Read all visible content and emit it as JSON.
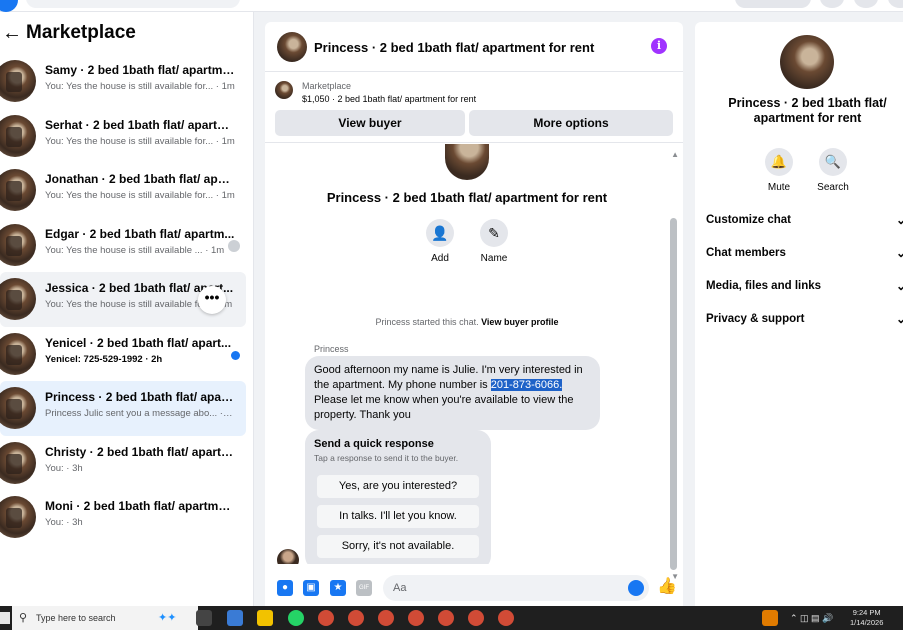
{
  "left": {
    "title": "Marketplace",
    "conversations": [
      {
        "title": "Samy · 2 bed 1bath flat/ apartmen...",
        "preview": "You: Yes the house is still available for... · 1m"
      },
      {
        "title": "Serhat · 2 bed 1bath flat/ apartme...",
        "preview": "You: Yes the house is still available for... · 1m"
      },
      {
        "title": "Jonathan · 2 bed 1bath flat/ apart...",
        "preview": "You: Yes the house is still available for... · 1m"
      },
      {
        "title": "Edgar · 2 bed 1bath flat/ apartm...",
        "preview": "You: Yes the house is still available ... · 1m"
      },
      {
        "title": "Jessica · 2 bed 1bath flat/ apart...",
        "preview": "You: Yes the house is still available fo... · 1m"
      },
      {
        "title": "Yenicel · 2 bed 1bath flat/ apart...",
        "preview": "Yenicel: 725-529-1992 · 2h"
      },
      {
        "title": "Princess · 2 bed 1bath flat/ apartm...",
        "preview": "Princess Julic sent you a message abo... · 2h"
      },
      {
        "title": "Christy · 2 bed 1bath flat/ apartme...",
        "preview": "You: · 3h"
      },
      {
        "title": "Moni · 2 bed 1bath flat/ apartment...",
        "preview": "You: · 3h"
      }
    ],
    "more_glyph": "•••"
  },
  "chat": {
    "title": "Princess · 2 bed 1bath flat/ apartment for rent",
    "info_glyph": "i",
    "listing": {
      "label": "Marketplace",
      "price_line": "$1,050 · 2 bed 1bath flat/ apartment for rent",
      "view_buyer": "View buyer",
      "more_options": "More options"
    },
    "conversation_name": "Princess · 2 bed 1bath flat/ apartment for rent",
    "actions": {
      "add": "Add",
      "name": "Name"
    },
    "started_prefix": "Princess started this chat.",
    "started_link": "View buyer profile",
    "sender": "Princess",
    "message_before": "Good afternoon my name is Julie. I'm very interested in the apartment. My phone number is ",
    "message_phone": "201-873-6066.",
    "message_after": "Please let me know when you're available to view the property. Thank you",
    "quick": {
      "title": "Send a quick response",
      "subtitle": "Tap a response to send it to the buyer.",
      "options": [
        "Yes, are you interested?",
        "In talks. I'll let you know.",
        "Sorry, it's not available."
      ]
    },
    "composer_placeholder": "Aa",
    "gif_label": "GIF"
  },
  "right": {
    "title": "Princess · 2 bed 1bath flat/ apartment for rent",
    "mute": "Mute",
    "search": "Search",
    "rows": [
      "Customize chat",
      "Chat members",
      "Media, files and links",
      "Privacy & support"
    ]
  },
  "taskbar": {
    "search_placeholder": "Type here to search",
    "time": "9:24 PM",
    "date": "1/14/2026"
  },
  "colors": {
    "accent": "#1877f2",
    "highlight": "#1e62c8",
    "info": "#a033ff"
  }
}
